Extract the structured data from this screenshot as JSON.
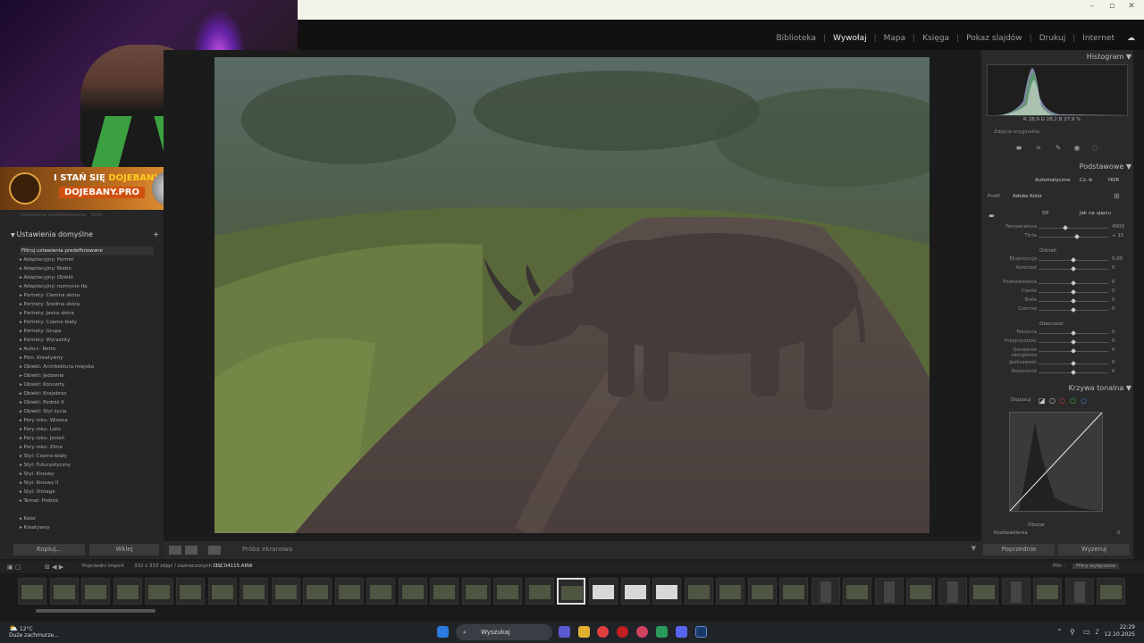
{
  "window": {
    "minimize": "–",
    "maximize": "▫",
    "close": "✕"
  },
  "modules": [
    "Biblioteka",
    "Wywołaj",
    "Mapa",
    "Księga",
    "Pokaz slajdów",
    "Drukuj",
    "Internet"
  ],
  "active_module": "Wywołaj",
  "promo": {
    "line1_a": "I STAŃ SIĘ ",
    "line1_b": "DOJEBANY",
    "line2": "DOJEBANY.PRO"
  },
  "left_panel": {
    "faded_a": "Ustawienie predefiniowane",
    "faded_b": "Brak",
    "section_title": "Ustawienia domyślne",
    "plus": "+",
    "items": [
      "Filtruj ustawienia predefiniowane",
      "Adaptacyjny: Portret",
      "Adaptacyjny: Niebo",
      "Adaptacyjny: Obiekt",
      "Adaptacyjny: rozmycie tła",
      "Portrety: Ciemna skóra",
      "Portrety: Średnia skóra",
      "Portrety: Jasna skóra",
      "Portrety: Czarno-biały",
      "Portrety: Grupa",
      "Portrety: Wyrazisty",
      "Auto+: Retro",
      "Film: Kreatywny",
      "Obiekt: Architektura miejska",
      "Obiekt: Jedzenie",
      "Obiekt: Koncerty",
      "Obiekt: Krajobraz",
      "Obiekt: Podróż II",
      "Obiekt: Styl życia",
      "Pory roku: Wiosna",
      "Pory roku: Lato",
      "Pory roku: Jesień",
      "Pory roku: Zima",
      "Styl: Czarno-biały",
      "Styl: Futurystyczny",
      "Styl: Kinowy",
      "Styl: Kinowy II",
      "Styl: Vintage",
      "Temat: Podróż"
    ],
    "items_extra": [
      "Kolor",
      "Kreatywny"
    ],
    "copy": "Kopiuj...",
    "paste": "Wklej"
  },
  "toolbar": {
    "label": "Próba ekranowa"
  },
  "right_panel": {
    "histogram_title": "Histogram",
    "hist_values": "R  28,9  G  28,2  B  27,9 %",
    "original_photo": "Zdjęcie oryginalne",
    "basic_title": "Podstawowe",
    "auto": "Automatyczne",
    "bw": "Cz.-b",
    "hdr": "HDR",
    "profile_label": "Profil",
    "profile_value": "Adobe Kolor",
    "wb_label": "BB",
    "wb_value": "Jak na ujęciu",
    "tone_label": "Odcień",
    "presence_label": "Obecność",
    "sliders": [
      {
        "label": "Temperatura",
        "value": "4900",
        "pos": 0.38
      },
      {
        "label": "Tinta",
        "value": "+ 15",
        "pos": 0.55
      },
      {
        "label": "Ekspozycja",
        "value": "0,00",
        "pos": 0.5
      },
      {
        "label": "Kontrast",
        "value": "0",
        "pos": 0.5
      },
      {
        "label": "Podświetlenia",
        "value": "0",
        "pos": 0.5
      },
      {
        "label": "Cienie",
        "value": "0",
        "pos": 0.5
      },
      {
        "label": "Bielе",
        "value": "0",
        "pos": 0.5
      },
      {
        "label": "Czernie",
        "value": "0",
        "pos": 0.5
      },
      {
        "label": "Tekstura",
        "value": "0",
        "pos": 0.5
      },
      {
        "label": "Przejrzystość",
        "value": "0",
        "pos": 0.5
      },
      {
        "label": "Usuwanie zamglenia",
        "value": "0",
        "pos": 0.5
      },
      {
        "label": "Jaskrawość",
        "value": "0",
        "pos": 0.5
      },
      {
        "label": "Nasycenie",
        "value": "0",
        "pos": 0.5
      }
    ],
    "curve_title": "Krzywa tonalna",
    "curve_adjust": "Dopasuj",
    "region_label": "Obszar",
    "region_slider": "Podświetlenia",
    "region_value": "0",
    "prev": "Poprzednie",
    "reset": "Wyzeruj"
  },
  "filmstrip_bar": {
    "prev_import": "Poprzedni import",
    "count": "332 z 333 zdjęć / zaznaczonych: 1 /",
    "filename": "DSC04115.ARW",
    "filter_label": "Filtr :",
    "filter_value": "Filtry wyłączone"
  },
  "taskbar": {
    "temp": "12°C",
    "weather": "Duże zachmurze...",
    "search": "Wyszukaj",
    "time": "22:29",
    "date": "12.10.2025"
  }
}
